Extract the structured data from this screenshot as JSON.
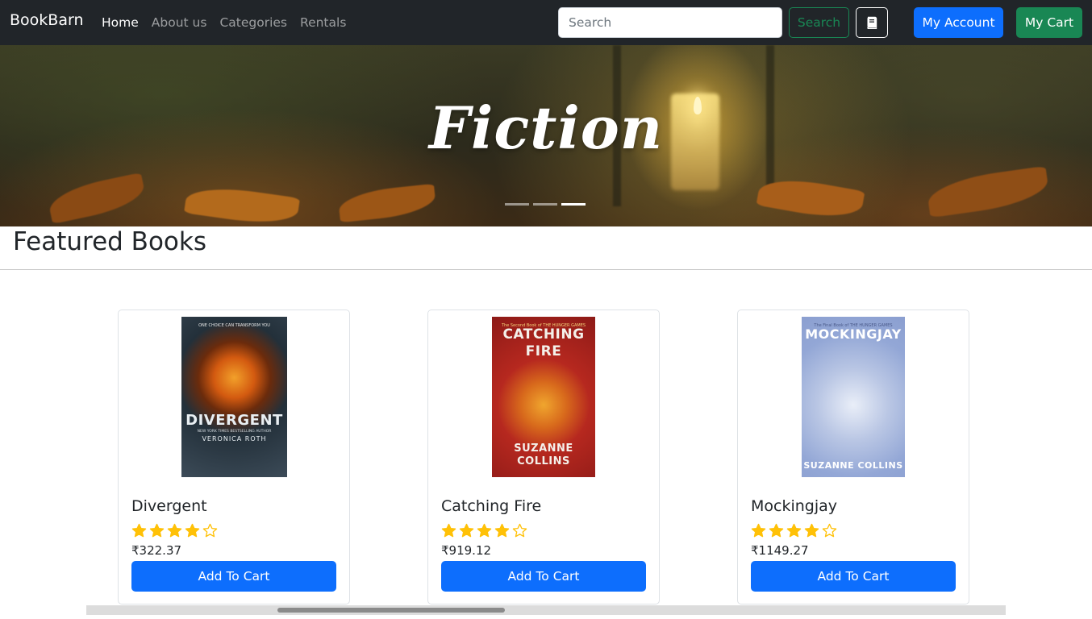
{
  "navbar": {
    "brand": "BookBarn",
    "links": [
      {
        "label": "Home",
        "active": true
      },
      {
        "label": "About us",
        "active": false
      },
      {
        "label": "Categories",
        "active": false
      },
      {
        "label": "Rentals",
        "active": false
      }
    ],
    "search": {
      "placeholder": "Search",
      "value": "",
      "button_label": "Search"
    },
    "book_icon": "book-icon",
    "account_label": "My Account",
    "cart_label": "My Cart"
  },
  "hero": {
    "title": "Fiction",
    "indicators": 3,
    "active_indicator": 2
  },
  "featured": {
    "title": "Featured Books",
    "books": [
      {
        "title": "Divergent",
        "rating": 4,
        "max_rating": 5,
        "price": "₹322.37",
        "button_label": "Add To Cart",
        "cover": {
          "tagline": "ONE CHOICE CAN TRANSFORM YOU",
          "big": "DIVERGENT",
          "author": "VERONICA ROTH",
          "sub": "NEW YORK TIMES BESTSELLING AUTHOR"
        }
      },
      {
        "title": "Catching Fire",
        "rating": 4,
        "max_rating": 5,
        "price": "₹919.12",
        "button_label": "Add To Cart",
        "cover": {
          "tagline": "The Second Book of THE HUNGER GAMES",
          "big": "CATCHING FIRE",
          "author": "SUZANNE COLLINS"
        }
      },
      {
        "title": "Mockingjay",
        "rating": 4,
        "max_rating": 5,
        "price": "₹1149.27",
        "button_label": "Add To Cart",
        "cover": {
          "tagline": "The Final Book of THE HUNGER GAMES",
          "big": "MOCKINGJAY",
          "author": "SUZANNE COLLINS"
        }
      }
    ]
  },
  "colors": {
    "navbar_bg": "#212529",
    "primary": "#0d6efd",
    "success": "#198754",
    "star": "#ffc107"
  }
}
